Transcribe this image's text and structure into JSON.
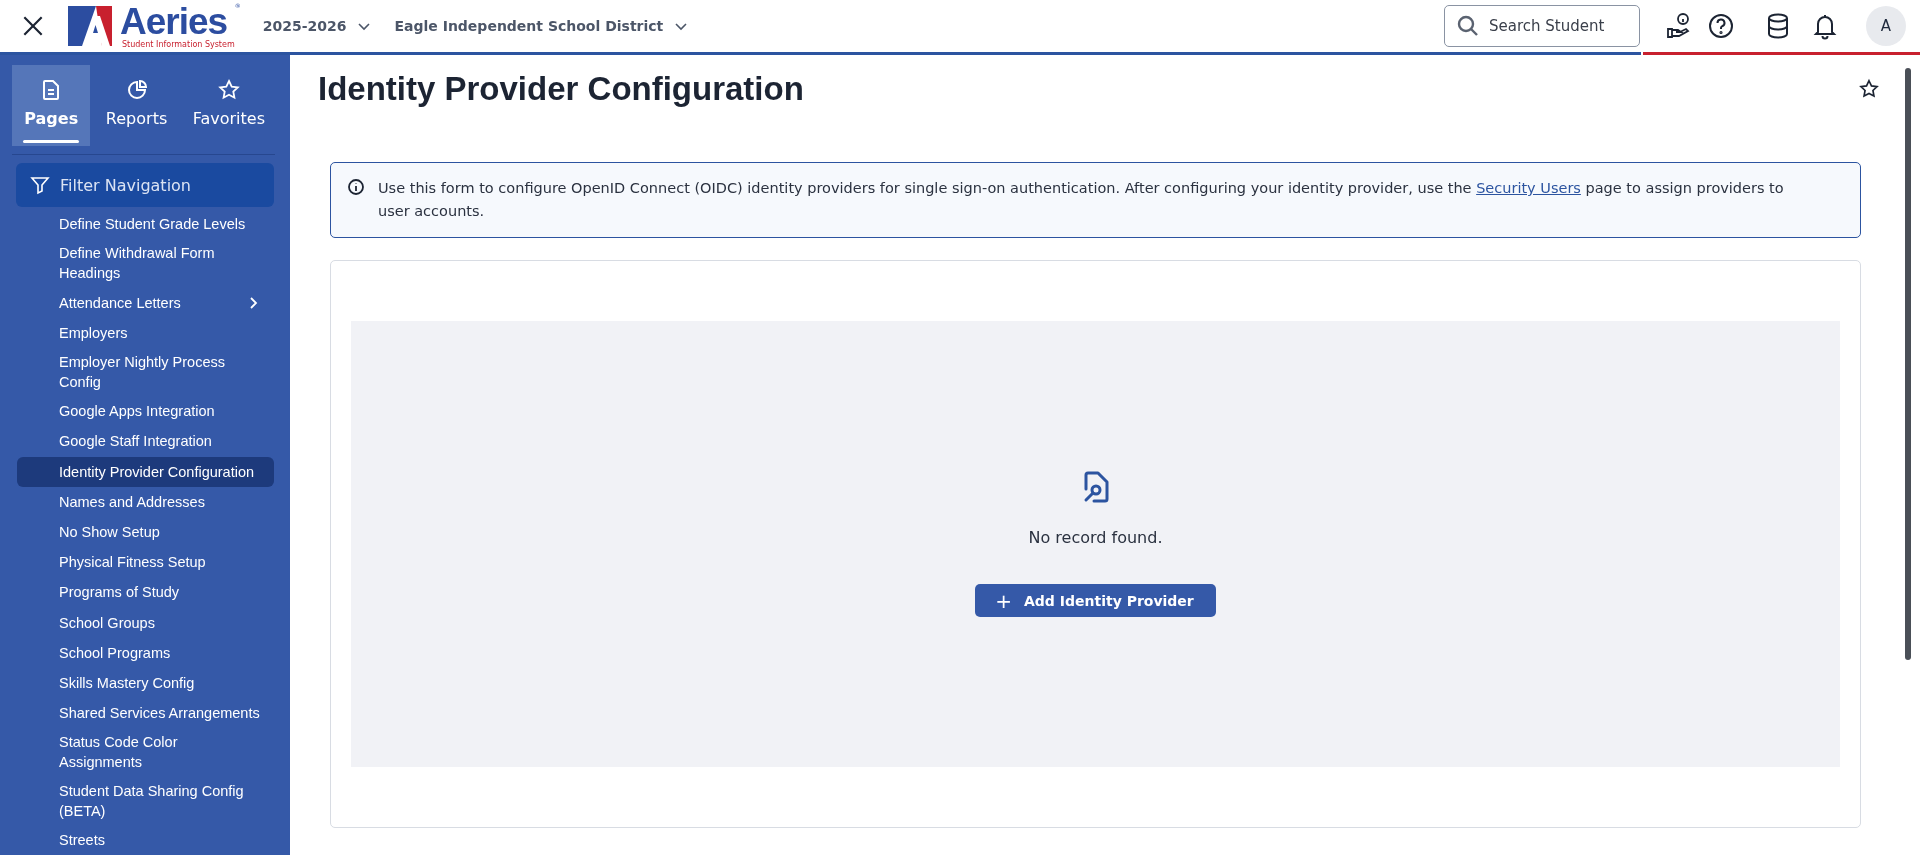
{
  "header": {
    "logo": {
      "name": "Aeries",
      "tagline": "Student Information System",
      "registered": "®"
    },
    "year": "2025-2026",
    "district": "Eagle Independent School District",
    "search": {
      "placeholder": "Search Student"
    },
    "avatar": "A"
  },
  "sidebar": {
    "tabs": [
      {
        "label": "Pages",
        "kind": "pages",
        "selected": true
      },
      {
        "label": "Reports",
        "kind": "reports",
        "selected": false
      },
      {
        "label": "Favorites",
        "kind": "favorites",
        "selected": false
      }
    ],
    "filter": {
      "placeholder": "Filter Navigation"
    },
    "items": [
      {
        "label": "Define Student Grade Levels",
        "selected": false
      },
      {
        "label": "Define Withdrawal Form Headings",
        "selected": false
      },
      {
        "label": "Attendance Letters",
        "selected": false,
        "has_submenu": true
      },
      {
        "label": "Employers",
        "selected": false
      },
      {
        "label": "Employer Nightly Process Config",
        "selected": false
      },
      {
        "label": "Google Apps Integration",
        "selected": false
      },
      {
        "label": "Google Staff Integration",
        "selected": false
      },
      {
        "label": "Identity Provider Configuration",
        "selected": true
      },
      {
        "label": "Names and Addresses",
        "selected": false
      },
      {
        "label": "No Show Setup",
        "selected": false
      },
      {
        "label": "Physical Fitness Setup",
        "selected": false
      },
      {
        "label": "Programs of Study",
        "selected": false
      },
      {
        "label": "School Groups",
        "selected": false
      },
      {
        "label": "School Programs",
        "selected": false
      },
      {
        "label": "Skills Mastery Config",
        "selected": false
      },
      {
        "label": "Shared Services Arrangements",
        "selected": false
      },
      {
        "label": "Status Code Color Assignments",
        "selected": false
      },
      {
        "label": "Student Data Sharing Config (BETA)",
        "selected": false
      },
      {
        "label": "Streets",
        "selected": false
      }
    ]
  },
  "page": {
    "title": "Identity Provider Configuration",
    "favorite": false,
    "info": {
      "before": "Use this form to configure OpenID Connect (OIDC) identity providers for single sign-on authentication. After configuring your identity provider, use the ",
      "link": "Security Users",
      "after": " page to assign providers to user accounts."
    },
    "empty": {
      "message": "No record found.",
      "button": "Add Identity Provider",
      "button_icon": "+"
    }
  }
}
